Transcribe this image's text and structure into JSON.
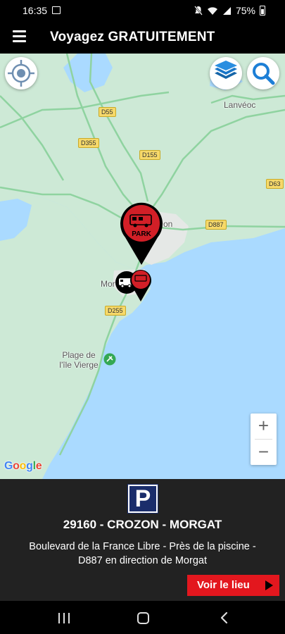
{
  "status_bar": {
    "time": "16:35",
    "battery": "75%",
    "icons": [
      "gallery-icon",
      "mute-icon",
      "wifi-icon",
      "signal-icon",
      "battery-icon"
    ]
  },
  "app_bar": {
    "title": "Voyagez GRATUITEMENT",
    "menu_icon": "hamburger-menu-icon"
  },
  "map": {
    "buttons": {
      "locate_icon": "crosshair-location-icon",
      "layers_icon": "layers-icon",
      "search_icon": "search-icon",
      "zoom_in": "+",
      "zoom_out": "−"
    },
    "road_labels": [
      "D55",
      "D355",
      "D155",
      "D63",
      "D887",
      "D255"
    ],
    "place_labels": {
      "lanveoc": "Lanvéoc",
      "morgat_partial": "Mor",
      "crozon_partial": "on",
      "plage_line1": "Plage de",
      "plage_line2": "l'île Vierge"
    },
    "attribution": [
      "G",
      "o",
      "o",
      "g",
      "l",
      "e"
    ],
    "markers": [
      "campervan-park-marker",
      "motorhome-marker"
    ],
    "marker_text": "PARK",
    "colors": {
      "water": "#aadaff",
      "land": "#cde9d6",
      "road": "#8fd3a0",
      "marker_red": "#d21f27"
    }
  },
  "info_panel": {
    "icon": "P",
    "title": "29160 - CROZON - MORGAT",
    "description": "Boulevard de la France Libre - Près de la piscine - D887 en direction de Morgat",
    "action_label": "Voir le lieu"
  },
  "nav_bar": {
    "icons": [
      "recents-icon",
      "home-icon",
      "back-icon"
    ]
  }
}
